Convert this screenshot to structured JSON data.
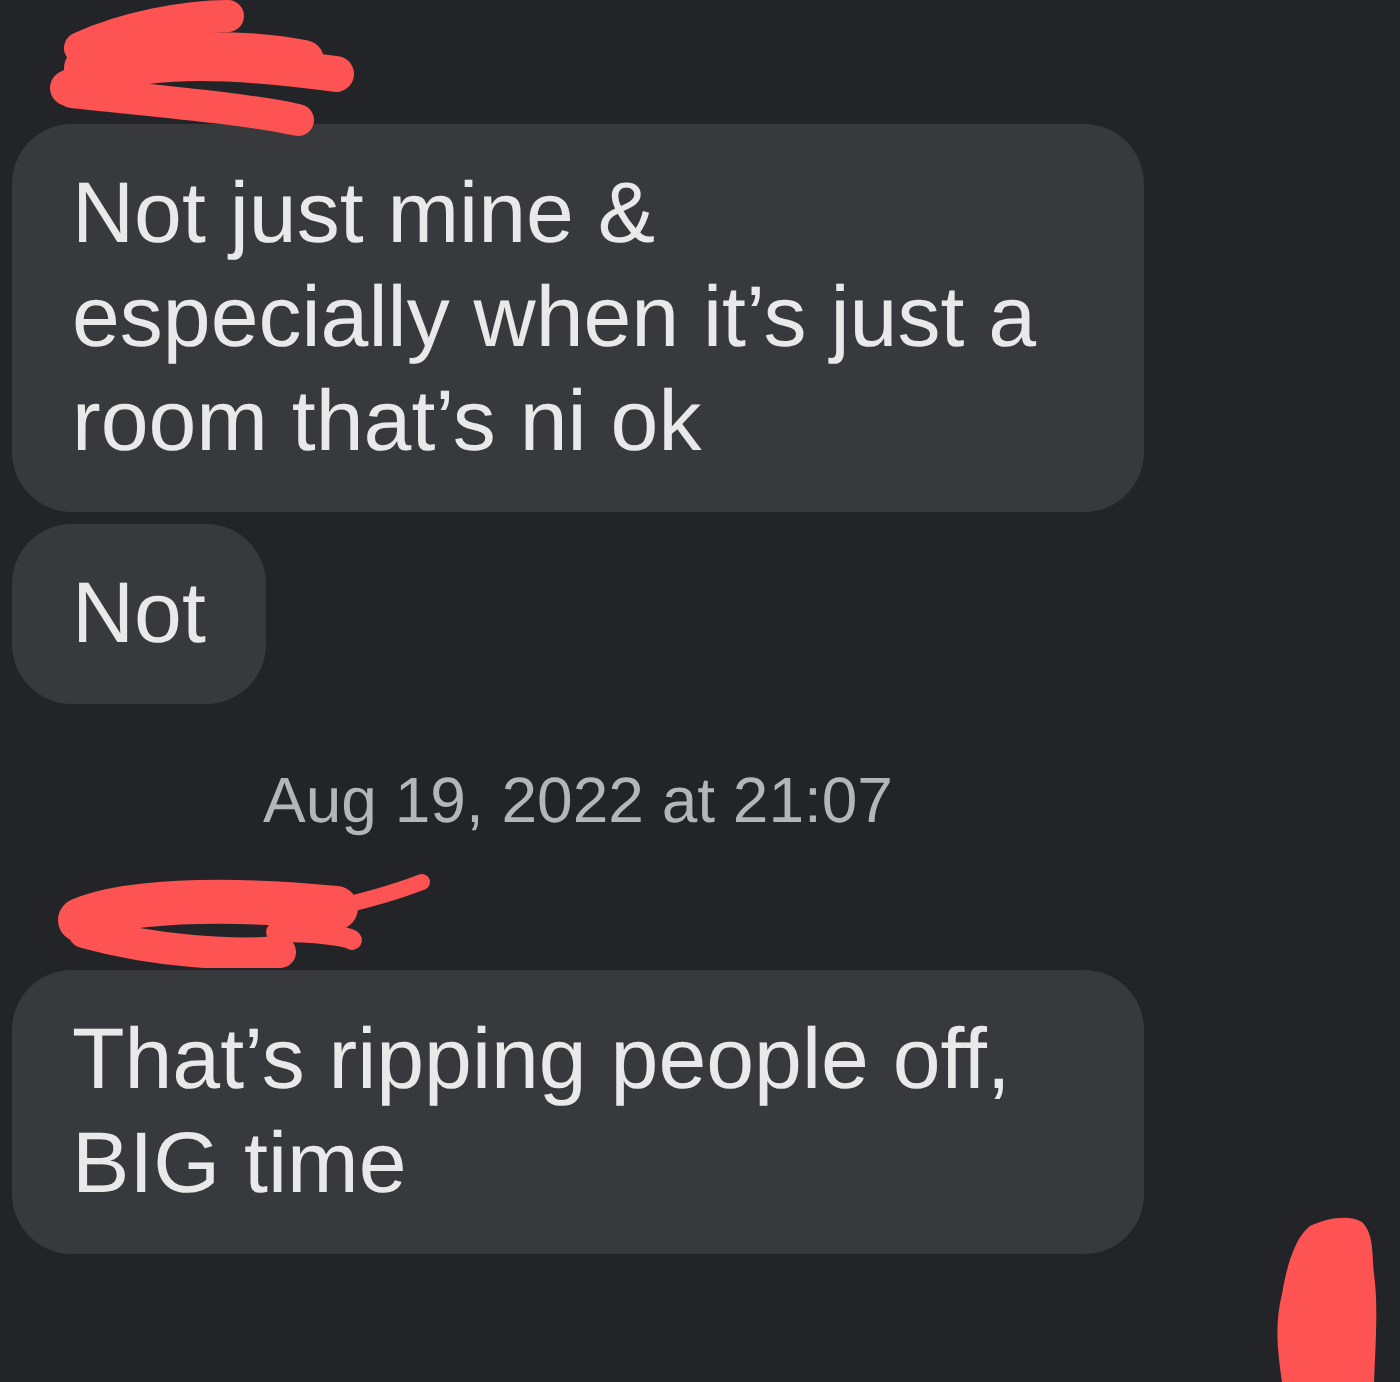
{
  "messages": [
    {
      "kind": "bubble",
      "text": "Not just mine &\nespecially when it’s just a room that’s ni ok"
    },
    {
      "kind": "bubble",
      "text": "Not"
    },
    {
      "kind": "timestamp",
      "text": "Aug 19, 2022 at 21:07"
    },
    {
      "kind": "bubble",
      "text": "That’s ripping people off, BIG time"
    }
  ]
}
